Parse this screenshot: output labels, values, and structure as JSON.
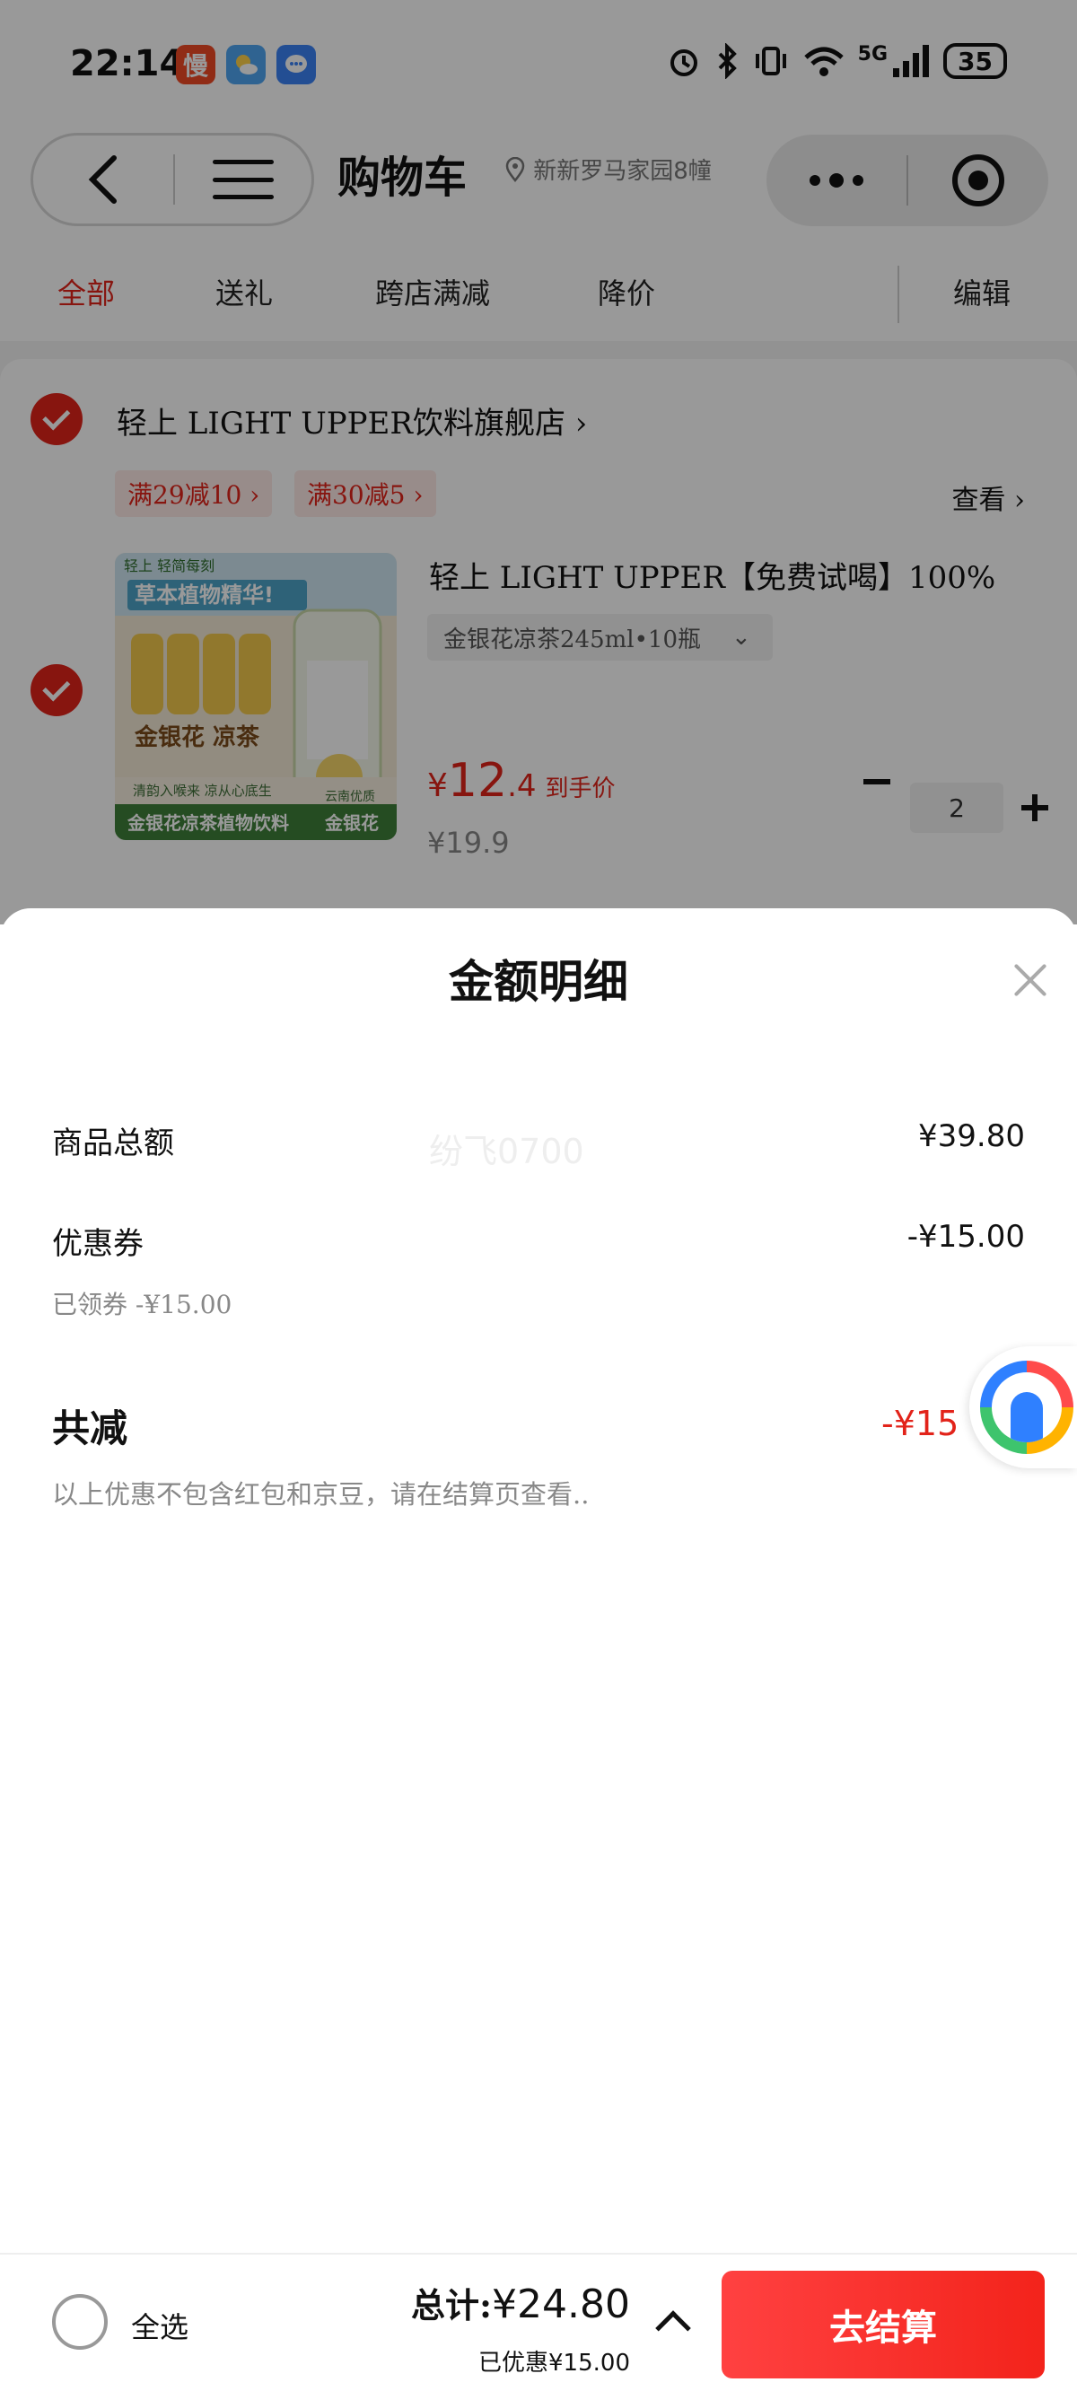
{
  "status_bar": {
    "time": "22:14",
    "app_badges": [
      "慢"
    ],
    "signal_label": "5G",
    "battery": "35"
  },
  "nav": {
    "title": "购物车",
    "location": "新新罗马家园8幢",
    "back_icon": "chevron-left-icon",
    "menu_icon": "hamburger-icon"
  },
  "tabs": [
    {
      "label": "全部",
      "active": true
    },
    {
      "label": "送礼",
      "active": false
    },
    {
      "label": "跨店满减",
      "active": false
    },
    {
      "label": "降价",
      "active": false
    }
  ],
  "edit_label": "编辑",
  "store": {
    "name": "轻上 LIGHT UPPER饮料旗舰店 ›",
    "promos": [
      "满29减10 ›",
      "满30减5 ›"
    ],
    "view_link": "查看 ›",
    "checked": true
  },
  "product": {
    "title": "轻上 LIGHT UPPER【免费试喝】100%",
    "spec": "金银花凉茶245ml•10瓶",
    "spec_caret": "⌄",
    "price_symbol": "¥",
    "price_int": "12",
    "price_dec": ".4",
    "price_tag": "到手价",
    "original_price": "¥19.9",
    "quantity": "2",
    "checked": true,
    "image_text": {
      "brand": "轻上 轻简每刻",
      "headline": "草本植物精华!",
      "can_label": "金银花 凉茶",
      "tagline": "清韵入喉来 凉从心底生",
      "origin": "云南优质",
      "origin_main": "金银花",
      "footer": "金银花凉茶植物饮料"
    }
  },
  "sheet": {
    "title": "金额明细",
    "rows": [
      {
        "label": "商品总额",
        "value": "¥39.80"
      },
      {
        "label": "优惠券",
        "value": "-¥15.00"
      }
    ],
    "coupon_sub": "已领券 -¥15.00",
    "watermark": "纷飞0700",
    "total_label": "共减",
    "total_value": "-¥15",
    "note": "以上优惠不包含红包和京豆，请在结算页查看.."
  },
  "bottom": {
    "select_all": "全选",
    "total_label": "总计:",
    "total_amount": "¥24.80",
    "saved_label": "已优惠",
    "saved_amount": "¥15.00",
    "checkout": "去结算"
  },
  "colors": {
    "accent": "#e2231a",
    "checkout_gradient_start": "#ff4141",
    "checkout_gradient_end": "#f3231b",
    "dim_overlay": "rgba(0,0,0,0.4)"
  }
}
